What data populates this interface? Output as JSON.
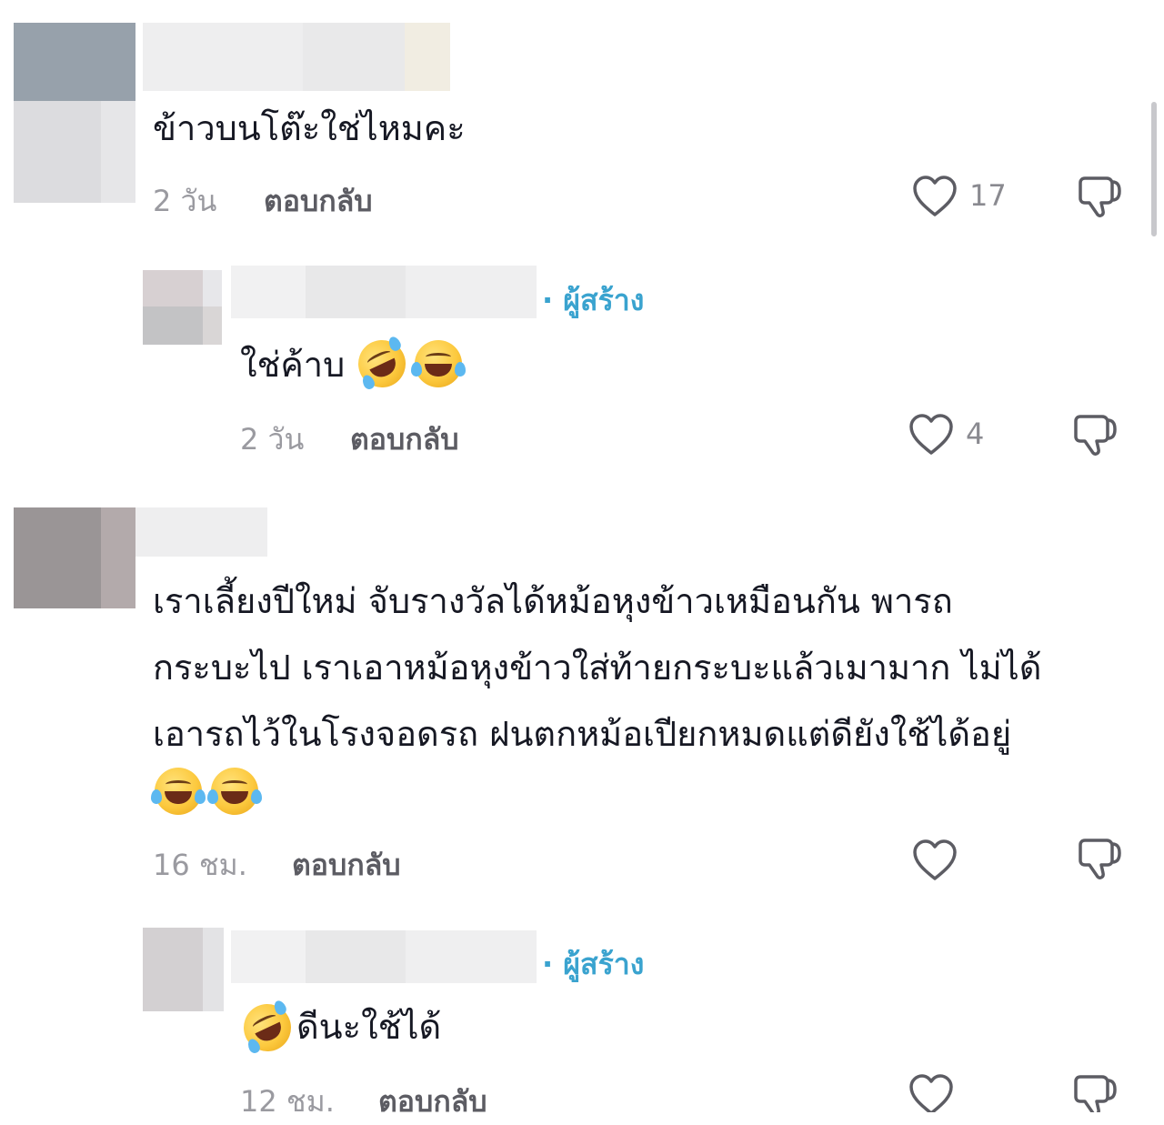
{
  "comments": [
    {
      "text": "ข้าวบนโต๊ะใช่ไหมคะ",
      "time": "2 วัน",
      "reply_label": "ตอบกลับ",
      "likes": "17",
      "replies": [
        {
          "creator_badge": "· ผู้สร้าง",
          "text": "ใช่ค้าบ",
          "time": "2 วัน",
          "reply_label": "ตอบกลับ",
          "likes": "4"
        }
      ]
    },
    {
      "text_lines": [
        "เราเลี้ยงปีใหม่ จับรางวัลได้หม้อหุงข้าวเหมือนกัน พารถ",
        "กระบะไป เราเอาหม้อหุงข้าวใส่ท้ายกระบะแล้วเมามาก ไม่ได้",
        "เอารถไว้ในโรงจอดรถ ฝนตกหม้อเปียกหมดแต่ดียังใช้ได้อยู่"
      ],
      "time": "16 ชม.",
      "reply_label": "ตอบกลับ",
      "likes": "",
      "replies": [
        {
          "creator_badge": "· ผู้สร้าง",
          "text": "ดีนะใช้ได้",
          "time": "12 ชม.",
          "reply_label": "ตอบกลับ",
          "likes": ""
        }
      ]
    }
  ],
  "icons": {
    "like": "heart-outline-icon",
    "dislike": "thumbs-down-icon",
    "emoji_rofl": "rolling-on-floor-laughing-emoji",
    "emoji_joy": "face-with-tears-of-joy-emoji"
  },
  "colors": {
    "text": "#161823",
    "meta": "#9a9aa0",
    "creator": "#3aa3cf"
  }
}
